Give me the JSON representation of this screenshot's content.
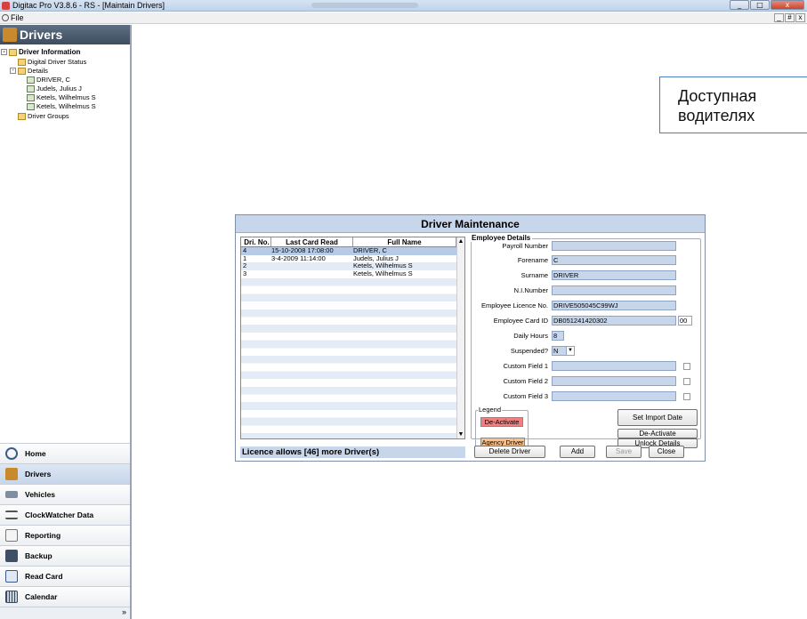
{
  "window": {
    "title": "Digitac Pro V3.8.6 - RS - [Maintain Drivers]",
    "controls": [
      "_",
      "□",
      "x"
    ]
  },
  "menu": {
    "file_label": "File",
    "mdi_controls": [
      "_",
      "#",
      "x"
    ]
  },
  "sidebar": {
    "header": "Drivers",
    "tree": {
      "root": "Driver Information",
      "digital_status": "Digital Driver Status",
      "details": "Details",
      "drivers": [
        "DRIVER, C",
        "Judels, Julius J",
        "Ketels, Wilhelmus S",
        "Ketels, Wilhelmus S"
      ],
      "groups": "Driver Groups"
    },
    "splitter_dots": "...........",
    "nav": [
      {
        "label": "Home",
        "icon": "clock-icon"
      },
      {
        "label": "Drivers",
        "icon": "drivers-icon"
      },
      {
        "label": "Vehicles",
        "icon": "vehicle-icon"
      },
      {
        "label": "ClockWatcher Data",
        "icon": "list-icon"
      },
      {
        "label": "Reporting",
        "icon": "report-icon"
      },
      {
        "label": "Backup",
        "icon": "backup-icon"
      },
      {
        "label": "Read Card",
        "icon": "card-icon"
      },
      {
        "label": "Calendar",
        "icon": "calendar-icon"
      }
    ],
    "more": "»"
  },
  "callout": {
    "line1": "Доступная",
    "line2": "водителях"
  },
  "dialog": {
    "title": "Driver Maintenance",
    "grid": {
      "headers": [
        "Dri. No.",
        "Last Card Read",
        "Full Name"
      ],
      "rows": [
        [
          "4",
          "15-10-2008 17:08:00",
          "DRIVER, C"
        ],
        [
          "1",
          "3-4-2009 11:14:00",
          "Judels, Julius J"
        ],
        [
          "2",
          "",
          "Ketels, Wilhelmus S"
        ],
        [
          "3",
          "",
          "Ketels, Wilhelmus S"
        ]
      ]
    },
    "licence": "Licence allows [46] more Driver(s)",
    "employee": {
      "legend": "Employee Details",
      "payroll_label": "Payroll Number",
      "payroll_value": "",
      "forename_label": "Forename",
      "forename_value": "C",
      "surname_label": "Surname",
      "surname_value": "DRIVER",
      "ni_label": "N.I.Number",
      "ni_value": "",
      "licence_label": "Employee Licence No.",
      "licence_value": "DRIVE505045C99WJ",
      "card_label": "Employee Card ID",
      "card_value": "DB051241420302",
      "card_ext": "00",
      "hours_label": "Daily Hours",
      "hours_value": "8",
      "suspended_label": "Suspended?",
      "suspended_value": "N",
      "custom1_label": "Custom Field 1",
      "custom1_value": "",
      "custom2_label": "Custom Field 2",
      "custom2_value": "",
      "custom3_label": "Custom Field 3",
      "custom3_value": ""
    },
    "legend": {
      "title": "Legend",
      "deactivate": "De-Activate",
      "agency": "Agency Driver",
      "deactivate_color": "#f08080",
      "agency_color": "#f8c08a"
    },
    "buttons": {
      "set_import": "Set Import Date",
      "deactivate": "De-Activate",
      "unlock": "Unlock Details",
      "delete": "Delete Driver",
      "add": "Add",
      "save": "Save",
      "close": "Close"
    }
  }
}
